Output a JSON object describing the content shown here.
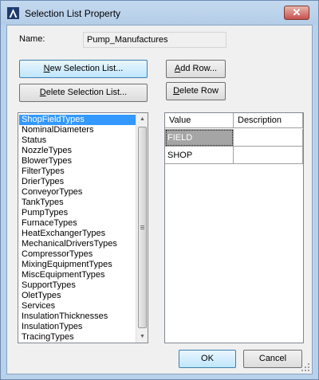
{
  "window": {
    "title": "Selection List Property",
    "close_glyph": "✕"
  },
  "name": {
    "label": "Name:",
    "value": "Pump_Manufactures"
  },
  "buttons": {
    "new_list_prefix": "N",
    "new_list_rest": "ew Selection List...",
    "add_row_prefix": "A",
    "add_row_rest": "dd Row...",
    "delete_list_prefix": "D",
    "delete_list_rest": "elete Selection List...",
    "delete_row_prefix": "D",
    "delete_row_rest": "elete Row",
    "ok": "OK",
    "cancel": "Cancel"
  },
  "selection_lists": {
    "selected_index": 0,
    "items": [
      "ShopFieldTypes",
      "NominalDiameters",
      "Status",
      "NozzleTypes",
      "BlowerTypes",
      "FilterTypes",
      "DrierTypes",
      "ConveyorTypes",
      "TankTypes",
      "PumpTypes",
      "FurnaceTypes",
      "HeatExchangerTypes",
      "MechanicalDriversTypes",
      "CompressorTypes",
      "MixingEquipmentTypes",
      "MiscEquipmentTypes",
      "SupportTypes",
      "OletTypes",
      "Services",
      "InsulationThicknesses",
      "InsulationTypes",
      "TracingTypes"
    ]
  },
  "grid": {
    "columns": [
      "Value",
      "Description"
    ],
    "rows": [
      {
        "value": "FIELD",
        "description": ""
      },
      {
        "value": "SHOP",
        "description": ""
      }
    ],
    "selected_row": 0
  },
  "icons": {
    "app": "autocad-a-icon",
    "scroll_up": "chevron-up-icon",
    "scroll_down": "chevron-down-icon"
  }
}
